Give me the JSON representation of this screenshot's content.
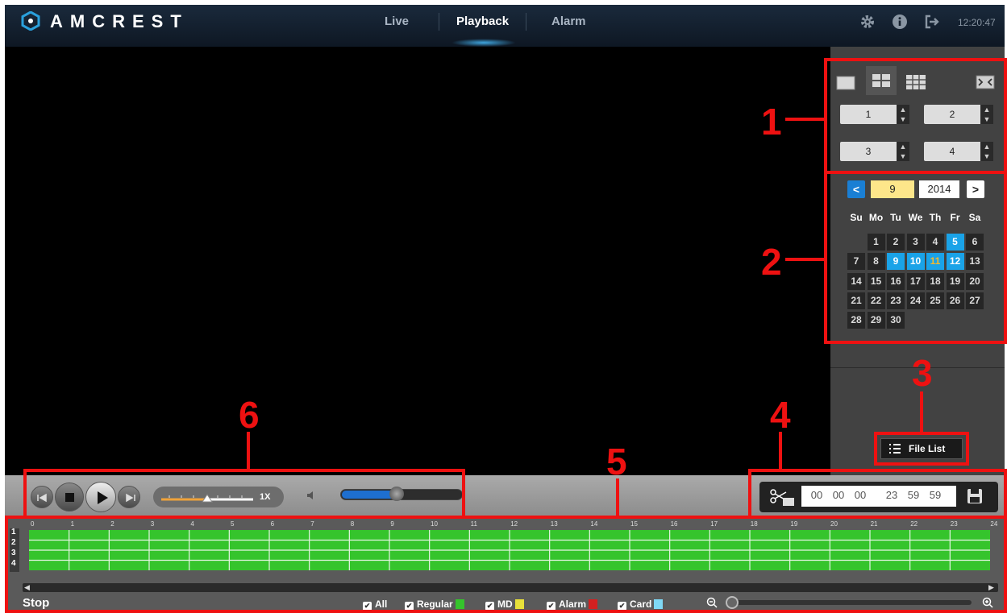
{
  "app": {
    "brand": "AMCREST",
    "nav_tabs": [
      {
        "label": "Live"
      },
      {
        "label": "Playback"
      },
      {
        "label": "Alarm"
      }
    ],
    "clock": "12:20:47",
    "icons": [
      "settings-gear-icon",
      "info-icon",
      "logout-icon"
    ]
  },
  "window_panel": {
    "layouts": [
      "single-view",
      "quad-view",
      "nine-view"
    ],
    "fullscreen_icon": "fullscreen-icon",
    "channels": [
      "1",
      "2",
      "3",
      "4"
    ]
  },
  "calendar": {
    "month": "9",
    "year": "2014",
    "weekdays": [
      "Su",
      "Mo",
      "Tu",
      "We",
      "Th",
      "Fr",
      "Sa"
    ],
    "days": [
      "1",
      "2",
      "3",
      "4",
      "5",
      "6",
      "7",
      "8",
      "9",
      "10",
      "11",
      "12",
      "13",
      "14",
      "15",
      "16",
      "17",
      "18",
      "19",
      "20",
      "21",
      "22",
      "23",
      "24",
      "25",
      "26",
      "27",
      "28",
      "29",
      "30"
    ],
    "recorded_days": [
      "5",
      "9",
      "10",
      "12"
    ],
    "today": "11",
    "colors": {
      "recorded": "#1aa3e8",
      "today_text": "#f5b82e"
    }
  },
  "file_list": {
    "label": "File List"
  },
  "playback": {
    "speed_label": "1X",
    "speed_position_fraction": 0.5,
    "volume_fraction": 0.45
  },
  "clip": {
    "start": [
      "00",
      "00",
      "00"
    ],
    "end": [
      "23",
      "59",
      "59"
    ]
  },
  "timeline": {
    "hours": [
      "0",
      "1",
      "2",
      "3",
      "4",
      "5",
      "6",
      "7",
      "8",
      "9",
      "10",
      "11",
      "12",
      "13",
      "14",
      "15",
      "16",
      "17",
      "18",
      "19",
      "20",
      "21",
      "22",
      "23",
      "24"
    ],
    "channels": [
      "1",
      "2",
      "3",
      "4"
    ],
    "status": "Stop",
    "filters": [
      {
        "label": "All",
        "color": ""
      },
      {
        "label": "Regular",
        "color": "#35c42c"
      },
      {
        "label": "MD",
        "color": "#e8e03a"
      },
      {
        "label": "Alarm",
        "color": "#d42020"
      },
      {
        "label": "Card",
        "color": "#7fd8f5"
      }
    ]
  },
  "annotations": [
    "1",
    "2",
    "3",
    "4",
    "5",
    "6"
  ]
}
